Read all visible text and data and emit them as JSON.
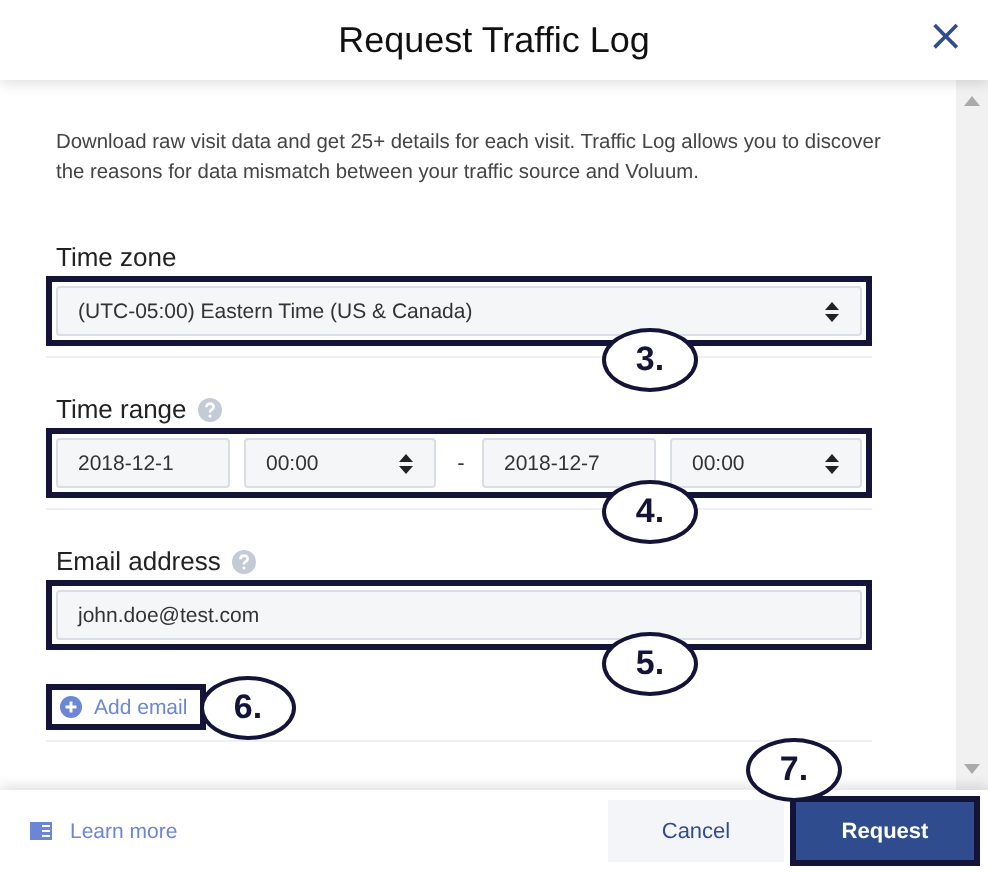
{
  "dialog": {
    "title": "Request Traffic Log",
    "close": "×"
  },
  "description": "Download raw visit data and get 25+ details for each visit. Traffic Log allows you to discover the reasons for data mismatch between your traffic source and Voluum.",
  "time_zone": {
    "label": "Time zone",
    "value": "(UTC-05:00) Eastern Time (US & Canada)"
  },
  "time_range": {
    "label": "Time range",
    "start_date": "2018-12-1",
    "start_time": "00:00",
    "separator": "-",
    "end_date": "2018-12-7",
    "end_time": "00:00"
  },
  "email": {
    "label": "Email address",
    "value": "john.doe@test.com"
  },
  "add_email": "Add email",
  "footer": {
    "learn_more": "Learn more",
    "cancel": "Cancel",
    "request": "Request"
  },
  "callouts": [
    {
      "label": "3."
    },
    {
      "label": "4."
    },
    {
      "label": "5."
    },
    {
      "label": "6."
    },
    {
      "label": "7."
    }
  ]
}
